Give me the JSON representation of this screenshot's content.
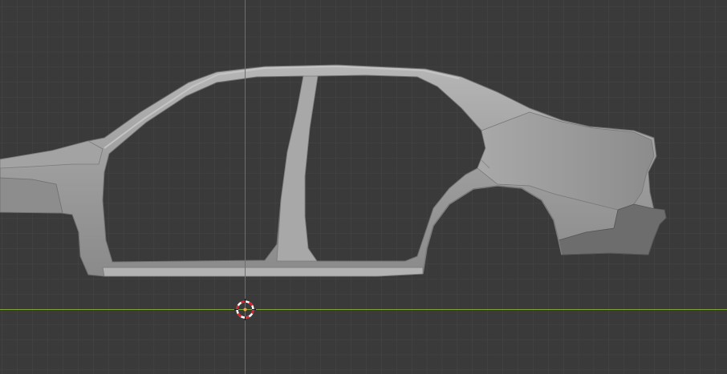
{
  "viewport": {
    "view": "orthographic-side",
    "colors": {
      "background": "#3a3a3a",
      "grid_minor": "#464646",
      "grid_major": "#303030",
      "x_axis": "#7fa536",
      "z_axis": "#3f77c2",
      "mesh_fill": "#8f8f8f",
      "mesh_highlight": "#b5b5b5",
      "mesh_shadow": "#6a6a6a",
      "cursor_red": "#d8232a",
      "cursor_white": "#ffffff",
      "origin": "#f2a93b"
    }
  },
  "scene": {
    "object": "car-body-shell",
    "gizmos": [
      "x-axis-line",
      "z-axis-line",
      "3d-cursor-icon"
    ]
  }
}
